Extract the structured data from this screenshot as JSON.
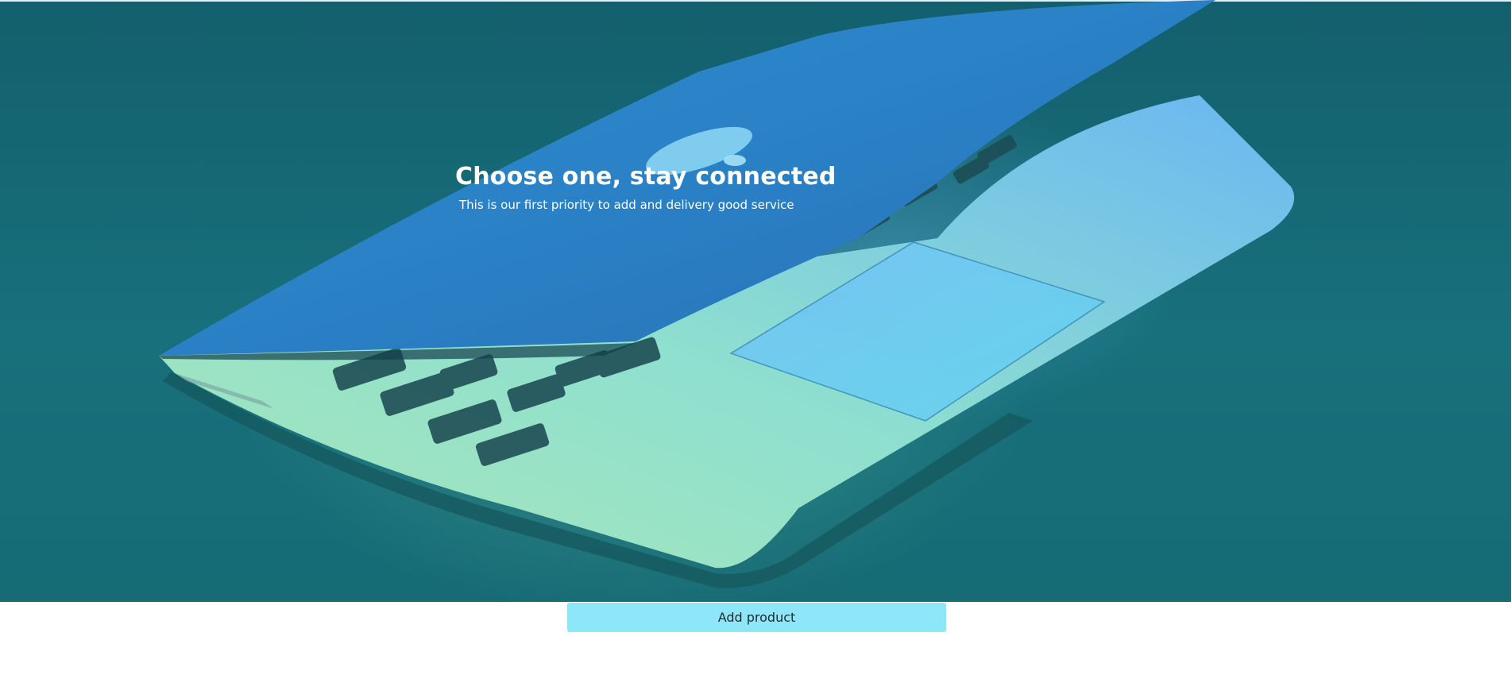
{
  "hero": {
    "title": "Choose one, stay connected",
    "subtitle": "This is our first priority to add and delivery good service",
    "background_image": "laptop-photo",
    "overlay_color": "#176a76"
  },
  "actions": {
    "add_product_label": "Add product",
    "add_product_color": "#8ee7f8"
  }
}
